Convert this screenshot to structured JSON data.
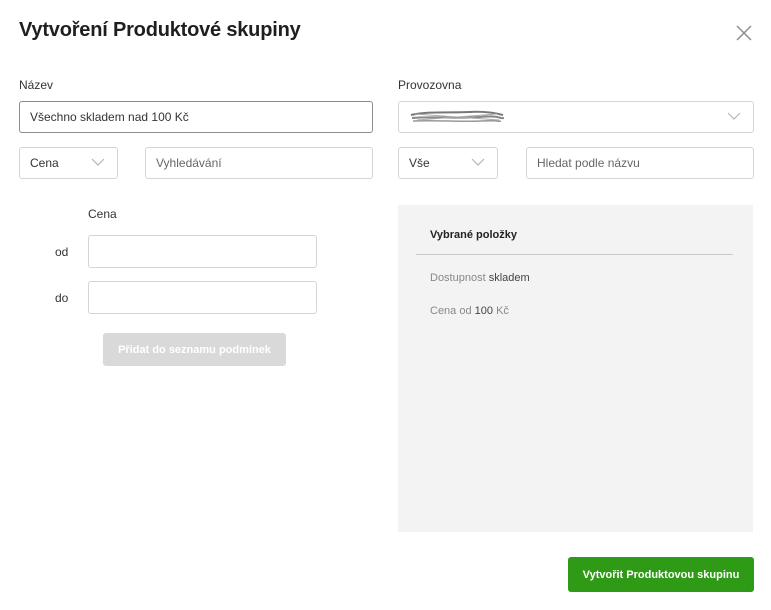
{
  "dialog": {
    "title": "Vytvoření Produktové skupiny",
    "close_icon": "close-icon"
  },
  "form": {
    "name_label": "Název",
    "name_value": "Všechno skladem nad 100 Kč",
    "branch_label": "Provozovna",
    "branch_value_redacted": true
  },
  "left_filters": {
    "type_select_value": "Cena",
    "search_placeholder": "Vyhledávání"
  },
  "right_filters": {
    "type_select_value": "Vše",
    "search_placeholder": "Hledat podle názvu"
  },
  "price_form": {
    "heading": "Cena",
    "from_label": "od",
    "to_label": "do",
    "from_value": "",
    "to_value": "",
    "add_button_label": "Přidat do seznamu podmínek"
  },
  "selected": {
    "title": "Vybrané položky",
    "conditions": [
      {
        "prefix": "Dostupnost",
        "value": "skladem",
        "suffix": ""
      },
      {
        "prefix": "Cena od",
        "value": "100",
        "suffix": "Kč"
      }
    ]
  },
  "actions": {
    "create_label": "Vytvořit Produktovou skupinu"
  },
  "colors": {
    "primary": "#2f9a16",
    "disabled": "#d9d9d9",
    "panel_bg": "#f3f3f3"
  }
}
